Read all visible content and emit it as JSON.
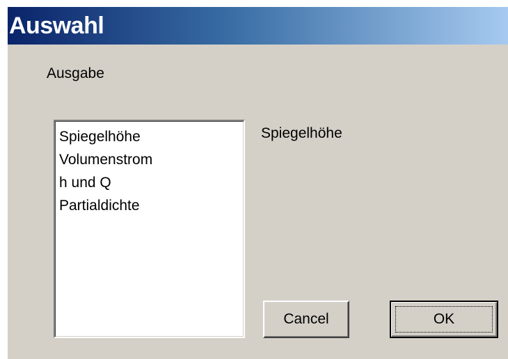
{
  "window": {
    "title": "Auswahl"
  },
  "dialog": {
    "group_label": "Ausgabe",
    "list_items": [
      "Spiegelhöhe",
      "Volumenstrom",
      "h und Q",
      "Partialdichte"
    ],
    "selected_value": "Spiegelhöhe"
  },
  "buttons": {
    "cancel_label": "Cancel",
    "ok_label": "OK"
  },
  "colors": {
    "titlebar_start": "#0a246a",
    "titlebar_end": "#a6caf0",
    "dialog_background": "#d4d0c8"
  }
}
